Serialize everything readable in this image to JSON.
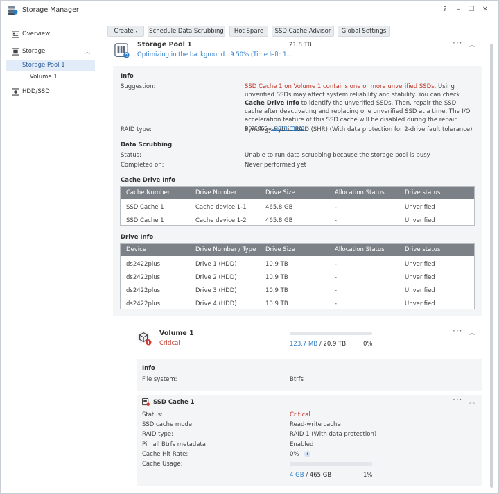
{
  "app": {
    "title": "Storage Manager"
  },
  "window_controls": {
    "help": "?",
    "minimize": "–",
    "maximize": "☐",
    "close": "✕"
  },
  "sidebar": {
    "overview": "Overview",
    "storage": "Storage",
    "storage_pool": "Storage Pool 1",
    "volume": "Volume 1",
    "hdd_ssd": "HDD/SSD"
  },
  "toolbar": {
    "create": "Create",
    "scrubbing": "Schedule Data Scrubbing",
    "hot_spare": "Hot Spare",
    "ssd_advisor": "SSD Cache Advisor",
    "global_settings": "Global Settings"
  },
  "pool": {
    "name": "Storage Pool 1",
    "status": "Optimizing in the background...9.50% (Time left: 1...",
    "size": "21.8 TB",
    "info_title": "Info",
    "suggestion_key": "Suggestion:",
    "suggestion_warn": "SSD Cache 1 on Volume 1 contains one or more unverified SSDs.",
    "suggestion_text_1": " Using unverified SSDs may affect system reliability and stability. You can check ",
    "suggestion_bold": "Cache Drive Info",
    "suggestion_text_2": " to identify the unverified SSDs. Then, repair the SSD cache after deactivating and replacing one unverified SSD at a time. The I/O acceleration feature of this SSD cache will be disabled during the repair process. ",
    "suggestion_link": "Learn more",
    "raid_key": "RAID type:",
    "raid_value": "Synology Hybrid RAID (SHR) (With data protection for 2-drive fault tolerance)",
    "scrub_title": "Data Scrubbing",
    "scrub_status_key": "Status:",
    "scrub_status_value": "Unable to run data scrubbing because the storage pool is busy",
    "scrub_completed_key": "Completed on:",
    "scrub_completed_value": "Never performed yet",
    "cache_title": "Cache Drive Info",
    "cache_headers": [
      "Cache Number",
      "Drive Number",
      "Drive Size",
      "Allocation Status",
      "Drive status"
    ],
    "cache_rows": [
      [
        "SSD Cache 1",
        "Cache device 1-1",
        "465.8 GB",
        "-",
        "Unverified"
      ],
      [
        "SSD Cache 1",
        "Cache device 1-2",
        "465.8 GB",
        "-",
        "Unverified"
      ]
    ],
    "drive_title": "Drive Info",
    "drive_headers": [
      "Device",
      "Drive Number / Type",
      "Drive Size",
      "Allocation Status",
      "Drive status"
    ],
    "drive_rows": [
      [
        "ds2422plus",
        "Drive 1 (HDD)",
        "10.9 TB",
        "-",
        "Unverified"
      ],
      [
        "ds2422plus",
        "Drive 2 (HDD)",
        "10.9 TB",
        "-",
        "Unverified"
      ],
      [
        "ds2422plus",
        "Drive 3 (HDD)",
        "10.9 TB",
        "-",
        "Unverified"
      ],
      [
        "ds2422plus",
        "Drive 4 (HDD)",
        "10.9 TB",
        "-",
        "Unverified"
      ]
    ]
  },
  "volume": {
    "name": "Volume 1",
    "status": "Critical",
    "used": "123.7 MB",
    "total": "/ 20.9 TB",
    "percent": "0%",
    "usage_fraction": 0.0,
    "info_title": "Info",
    "fs_key": "File system:",
    "fs_value": "Btrfs"
  },
  "ssd_cache": {
    "name": "SSD Cache 1",
    "status_key": "Status:",
    "status_value": "Critical",
    "mode_key": "SSD cache mode:",
    "mode_value": "Read-write cache",
    "raid_key": "RAID type:",
    "raid_value": "RAID 1 (With data protection)",
    "pin_key": "Pin all Btrfs metadata:",
    "pin_value": "Enabled",
    "hit_key": "Cache Hit Rate:",
    "hit_value": "0%",
    "usage_key": "Cache Usage:",
    "usage_used": "4 GB",
    "usage_total": "/ 465 GB",
    "usage_percent": "1%",
    "usage_fraction": 0.01
  },
  "colors": {
    "accent": "#2d7cc6",
    "critical": "#c0392b",
    "table_header": "#7b8187"
  }
}
